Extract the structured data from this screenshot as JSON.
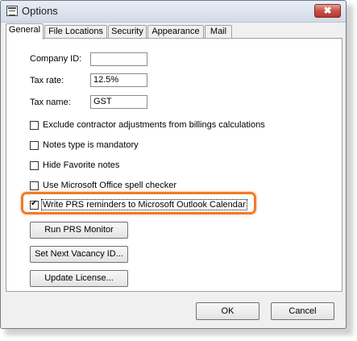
{
  "window": {
    "title": "Options",
    "close_glyph": "✖"
  },
  "tabs": [
    {
      "label": "General",
      "active": true
    },
    {
      "label": "File Locations",
      "active": false
    },
    {
      "label": "Security",
      "active": false
    },
    {
      "label": "Appearance",
      "active": false
    },
    {
      "label": "Mail",
      "active": false
    }
  ],
  "fields": {
    "company_id": {
      "label": "Company ID:",
      "value": ""
    },
    "tax_rate": {
      "label": "Tax rate:",
      "value": "12.5%"
    },
    "tax_name": {
      "label": "Tax name:",
      "value": "GST"
    }
  },
  "checkboxes": [
    {
      "label": "Exclude  contractor adjustments from billings calculations",
      "checked": false
    },
    {
      "label": "Notes type is mandatory",
      "checked": false
    },
    {
      "label": "Hide Favorite notes",
      "checked": false
    },
    {
      "label": "Use Microsoft Office spell checker",
      "checked": false
    },
    {
      "label": "Write PRS reminders to Microsoft Outlook Calendar",
      "checked": true
    }
  ],
  "action_buttons": [
    {
      "label": "Run PRS Monitor"
    },
    {
      "label": "Set Next Vacancy ID..."
    },
    {
      "label": "Update License..."
    }
  ],
  "footer": {
    "ok_label": "OK",
    "cancel_label": "Cancel"
  },
  "colors": {
    "highlight": "#f07c28",
    "close_button": "#c75050"
  }
}
